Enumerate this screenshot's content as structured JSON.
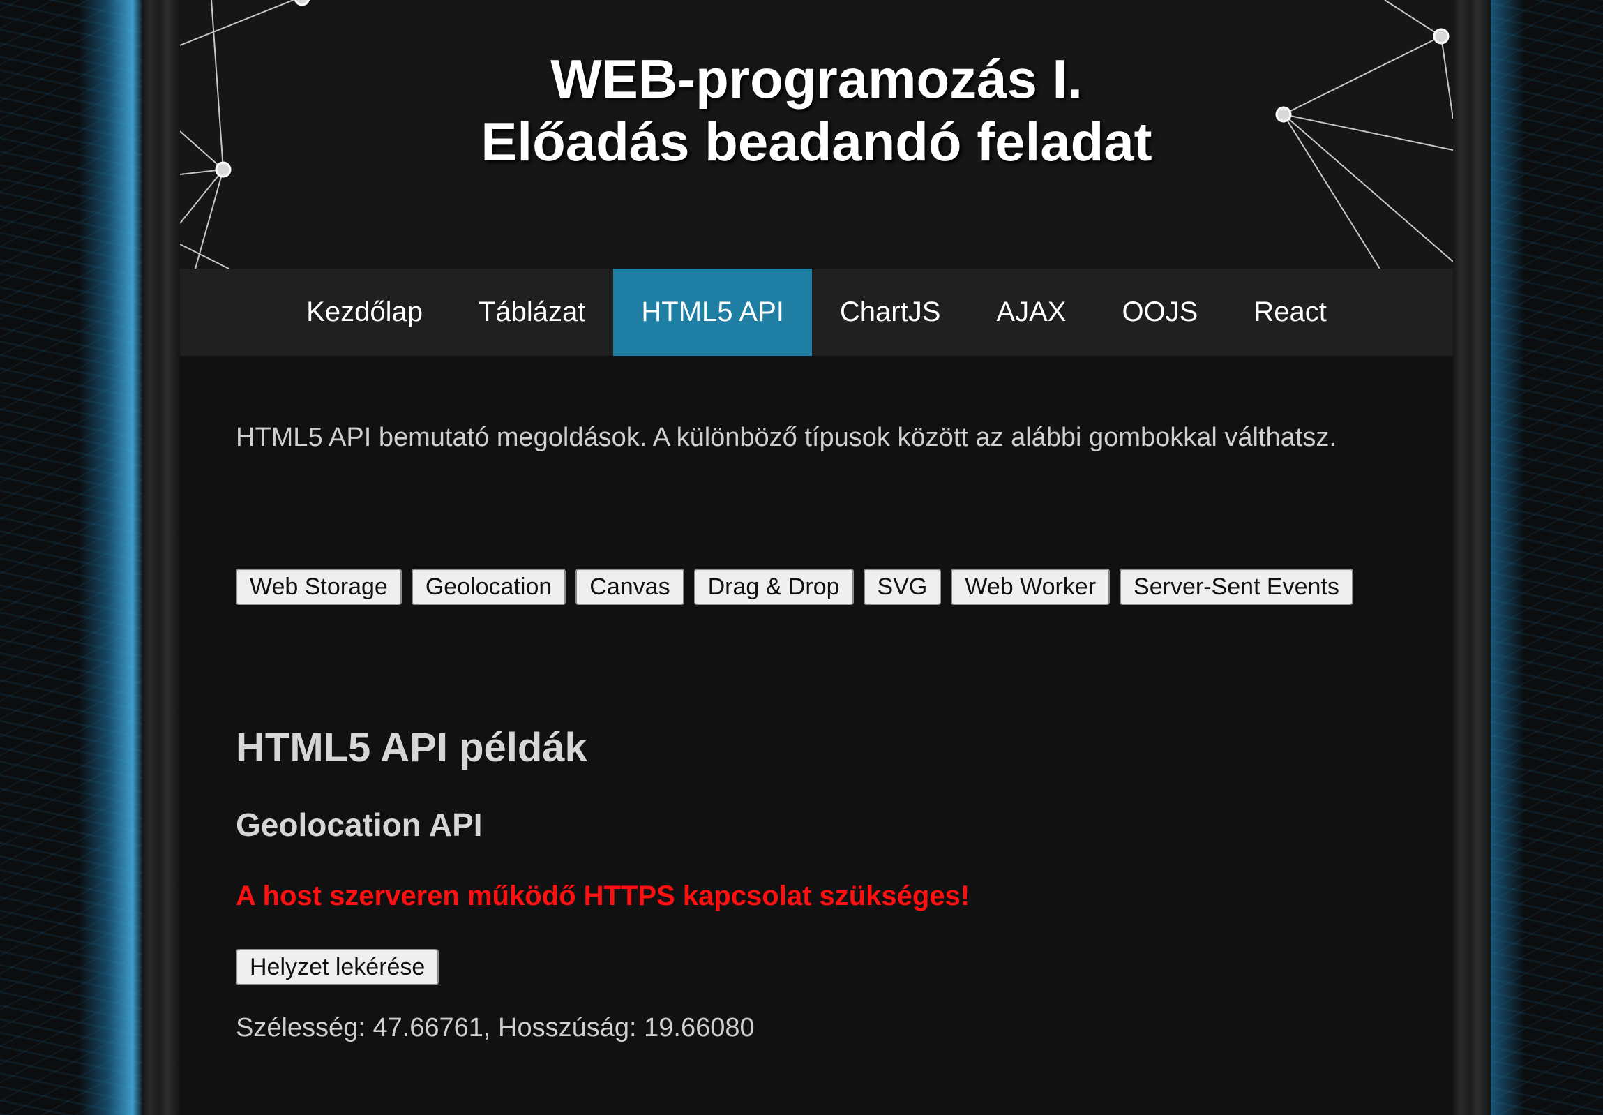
{
  "header": {
    "title_line1": "WEB-programozás I.",
    "title_line2": "Előadás beadandó feladat"
  },
  "nav": {
    "items": [
      {
        "label": "Kezdőlap"
      },
      {
        "label": "Táblázat"
      },
      {
        "label": "HTML5 API",
        "active": true
      },
      {
        "label": "ChartJS"
      },
      {
        "label": "AJAX"
      },
      {
        "label": "OOJS"
      },
      {
        "label": "React"
      }
    ],
    "active_color": "#1f7ea4"
  },
  "main": {
    "intro": "HTML5 API bemutató megoldások. A különböző típusok között az alábbi gombokkal válthatsz.",
    "api_buttons": [
      {
        "label": "Web Storage"
      },
      {
        "label": "Geolocation"
      },
      {
        "label": "Canvas"
      },
      {
        "label": "Drag & Drop"
      },
      {
        "label": "SVG"
      },
      {
        "label": "Web Worker"
      },
      {
        "label": "Server-Sent Events"
      }
    ],
    "heading": "HTML5 API példák",
    "subheading": "Geolocation API",
    "warning": "A host szerveren működő HTTPS kapcsolat szükséges!",
    "warning_color": "#ff1010",
    "locate_button": "Helyzet lekérése",
    "coords": "Szélesség: 47.66761, Hosszúság: 19.66080"
  }
}
